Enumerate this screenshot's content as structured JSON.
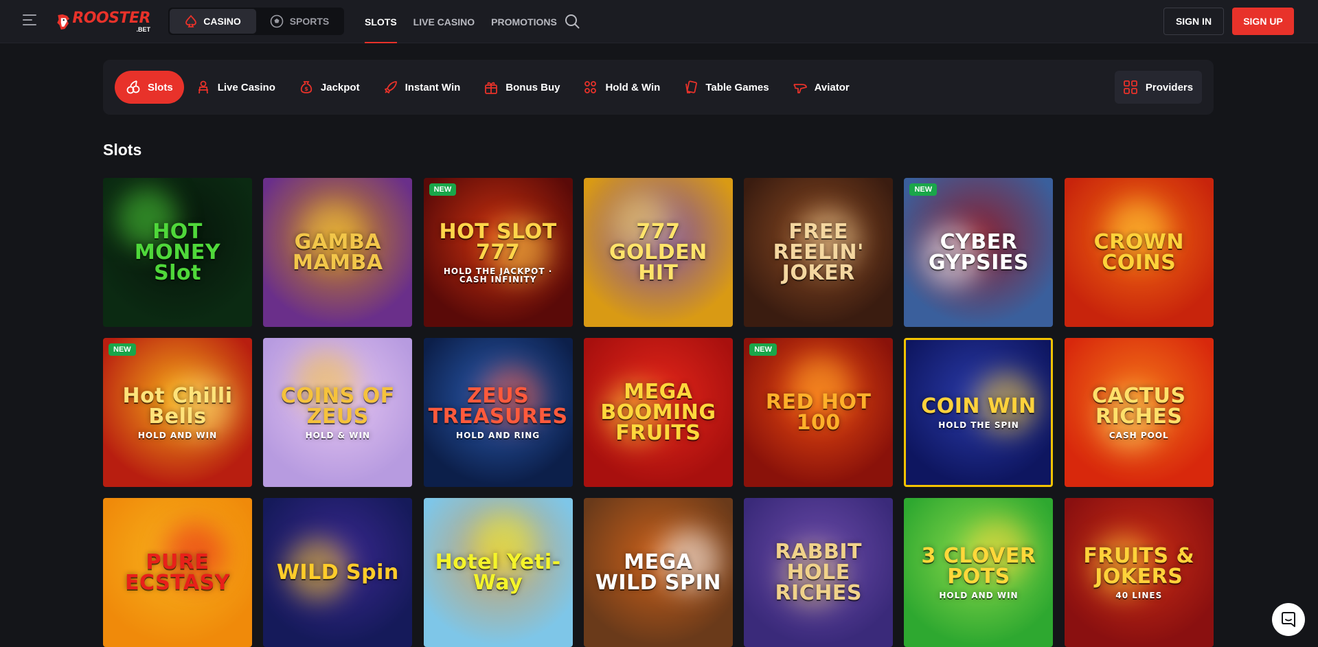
{
  "header": {
    "logo_text": "ROOSTER",
    "logo_suffix": ".BET",
    "segments": [
      {
        "label": "CASINO",
        "icon": "spade-icon",
        "active": true
      },
      {
        "label": "SPORTS",
        "icon": "soccer-ball-icon",
        "active": false
      }
    ],
    "nav": [
      {
        "label": "SLOTS",
        "active": true
      },
      {
        "label": "LIVE CASINO",
        "active": false
      },
      {
        "label": "PROMOTIONS",
        "active": false
      }
    ],
    "sign_in": "SIGN IN",
    "sign_up": "SIGN UP"
  },
  "categories": [
    {
      "label": "Slots",
      "icon": "cherries-icon",
      "active": true
    },
    {
      "label": "Live Casino",
      "icon": "dealer-icon",
      "active": false
    },
    {
      "label": "Jackpot",
      "icon": "money-bag-icon",
      "active": false
    },
    {
      "label": "Instant Win",
      "icon": "rocket-icon",
      "active": false
    },
    {
      "label": "Bonus Buy",
      "icon": "gift-icon",
      "active": false
    },
    {
      "label": "Hold & Win",
      "icon": "coins-icon",
      "active": false
    },
    {
      "label": "Table Games",
      "icon": "cards-icon",
      "active": false
    },
    {
      "label": "Aviator",
      "icon": "plane-icon",
      "active": false
    }
  ],
  "providers_label": "Providers",
  "section_title": "Slots",
  "games": [
    {
      "title": "HOT MONEY Slot",
      "sub": "",
      "badge": "",
      "bg": "#0b2a12",
      "bg2": "#06140a",
      "fg": "#4fd83a"
    },
    {
      "title": "GAMBA MAMBA",
      "sub": "",
      "badge": "",
      "bg": "#6a2f8a",
      "bg2": "#c9871c",
      "fg": "#f2c64a"
    },
    {
      "title": "HOT SLOT 777",
      "sub": "HOLD THE JACKPOT · CASH INFINITY",
      "badge": "NEW",
      "bg": "#5a0a08",
      "bg2": "#c8310f",
      "fg": "#ffd54a"
    },
    {
      "title": "777 GOLDEN HIT",
      "sub": "",
      "badge": "",
      "bg": "#d99a14",
      "bg2": "#7a4da8",
      "fg": "#ffe36a"
    },
    {
      "title": "FREE REELIN' JOKER",
      "sub": "",
      "badge": "",
      "bg": "#3a1c10",
      "bg2": "#8a4a22",
      "fg": "#f4d7a0"
    },
    {
      "title": "CYBER GYPSIES",
      "sub": "",
      "badge": "NEW",
      "bg": "#3a5f9c",
      "bg2": "#8a2030",
      "fg": "#ffffff"
    },
    {
      "title": "CROWN COINS",
      "sub": "",
      "badge": "",
      "bg": "#c8240c",
      "bg2": "#f06a10",
      "fg": "#ffd23a"
    },
    {
      "title": "Hot Chilli Bells",
      "sub": "HOLD AND WIN",
      "badge": "NEW",
      "bg": "#b81e10",
      "bg2": "#f4a818",
      "fg": "#ffe37a"
    },
    {
      "title": "COINS OF ZEUS",
      "sub": "HOLD & WIN",
      "badge": "",
      "bg": "#b79be0",
      "bg2": "#e4c4f0",
      "fg": "#f5c23c"
    },
    {
      "title": "ZEUS TREASURES",
      "sub": "HOLD AND RING",
      "badge": "",
      "bg": "#0c1f4a",
      "bg2": "#2a5bb0",
      "fg": "#ff5a3c"
    },
    {
      "title": "MEGA BOOMING FRUITS",
      "sub": "",
      "badge": "",
      "bg": "#a8100e",
      "bg2": "#e3261a",
      "fg": "#ffd73c"
    },
    {
      "title": "RED HOT 100",
      "sub": "",
      "badge": "NEW",
      "bg": "#8a120a",
      "bg2": "#e84a10",
      "fg": "#ffb02a"
    },
    {
      "title": "COIN WIN",
      "sub": "HOLD THE SPIN",
      "badge": "",
      "bg": "#0e1660",
      "bg2": "#2a3aa8",
      "fg": "#ffd23c"
    },
    {
      "title": "CACTUS RICHES",
      "sub": "CASH POOL",
      "badge": "",
      "bg": "#d8280c",
      "bg2": "#f27418",
      "fg": "#ffe06a"
    },
    {
      "title": "PURE ECSTASY",
      "sub": "",
      "badge": "",
      "bg": "#f08a0a",
      "bg2": "#f7b21c",
      "fg": "#e8201a"
    },
    {
      "title": "WILD Spin",
      "sub": "",
      "badge": "",
      "bg": "#151a5a",
      "bg2": "#3a2890",
      "fg": "#ffcc2a"
    },
    {
      "title": "Hotel Yeti-Way",
      "sub": "",
      "badge": "",
      "bg": "#7ec6e8",
      "bg2": "#c8a26a",
      "fg": "#f4f42a"
    },
    {
      "title": "MEGA WILD SPIN",
      "sub": "",
      "badge": "",
      "bg": "#6a3a1a",
      "bg2": "#c8601a",
      "fg": "#ffffff"
    },
    {
      "title": "RABBIT HOLE RICHES",
      "sub": "",
      "badge": "",
      "bg": "#3a2a7a",
      "bg2": "#6a4aa8",
      "fg": "#f0d28a"
    },
    {
      "title": "3 CLOVER POTS",
      "sub": "HOLD AND WIN",
      "badge": "",
      "bg": "#2ea830",
      "bg2": "#8ad84a",
      "fg": "#ffd83a"
    },
    {
      "title": "FRUITS & JOKERS",
      "sub": "40 LINES",
      "badge": "",
      "bg": "#8a1010",
      "bg2": "#c82c14",
      "fg": "#ffd23a"
    }
  ]
}
